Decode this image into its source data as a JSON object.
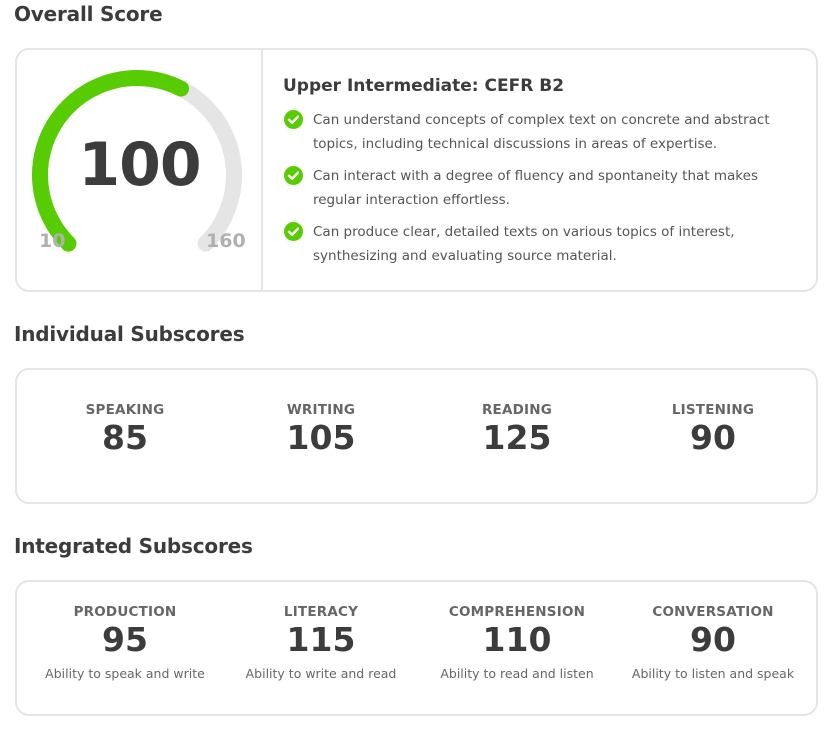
{
  "overall": {
    "title": "Overall Score",
    "score": "100",
    "min": "10",
    "max": "160",
    "score_value": 100,
    "min_value": 10,
    "max_value": 160,
    "accent_color": "#58cc02",
    "track_color": "#e5e5e5",
    "level_title": "Upper Intermediate: CEFR B2",
    "descriptions": [
      "Can understand concepts of complex text on concrete and abstract topics, including technical discussions in areas of expertise.",
      "Can interact with a degree of fluency and spontaneity that makes regular interaction effortless.",
      "Can produce clear, detailed texts on various topics of interest, synthesizing and evaluating source material."
    ],
    "check_icon": "check-circle-icon"
  },
  "individual": {
    "title": "Individual Subscores",
    "items": [
      {
        "label": "SPEAKING",
        "score": "85"
      },
      {
        "label": "WRITING",
        "score": "105"
      },
      {
        "label": "READING",
        "score": "125"
      },
      {
        "label": "LISTENING",
        "score": "90"
      }
    ]
  },
  "integrated": {
    "title": "Integrated Subscores",
    "items": [
      {
        "label": "PRODUCTION",
        "score": "95",
        "description": "Ability to speak and write"
      },
      {
        "label": "LITERACY",
        "score": "115",
        "description": "Ability to write and read"
      },
      {
        "label": "COMPREHENSION",
        "score": "110",
        "description": "Ability to read and listen"
      },
      {
        "label": "CONVERSATION",
        "score": "90",
        "description": "Ability to listen and speak"
      }
    ]
  }
}
